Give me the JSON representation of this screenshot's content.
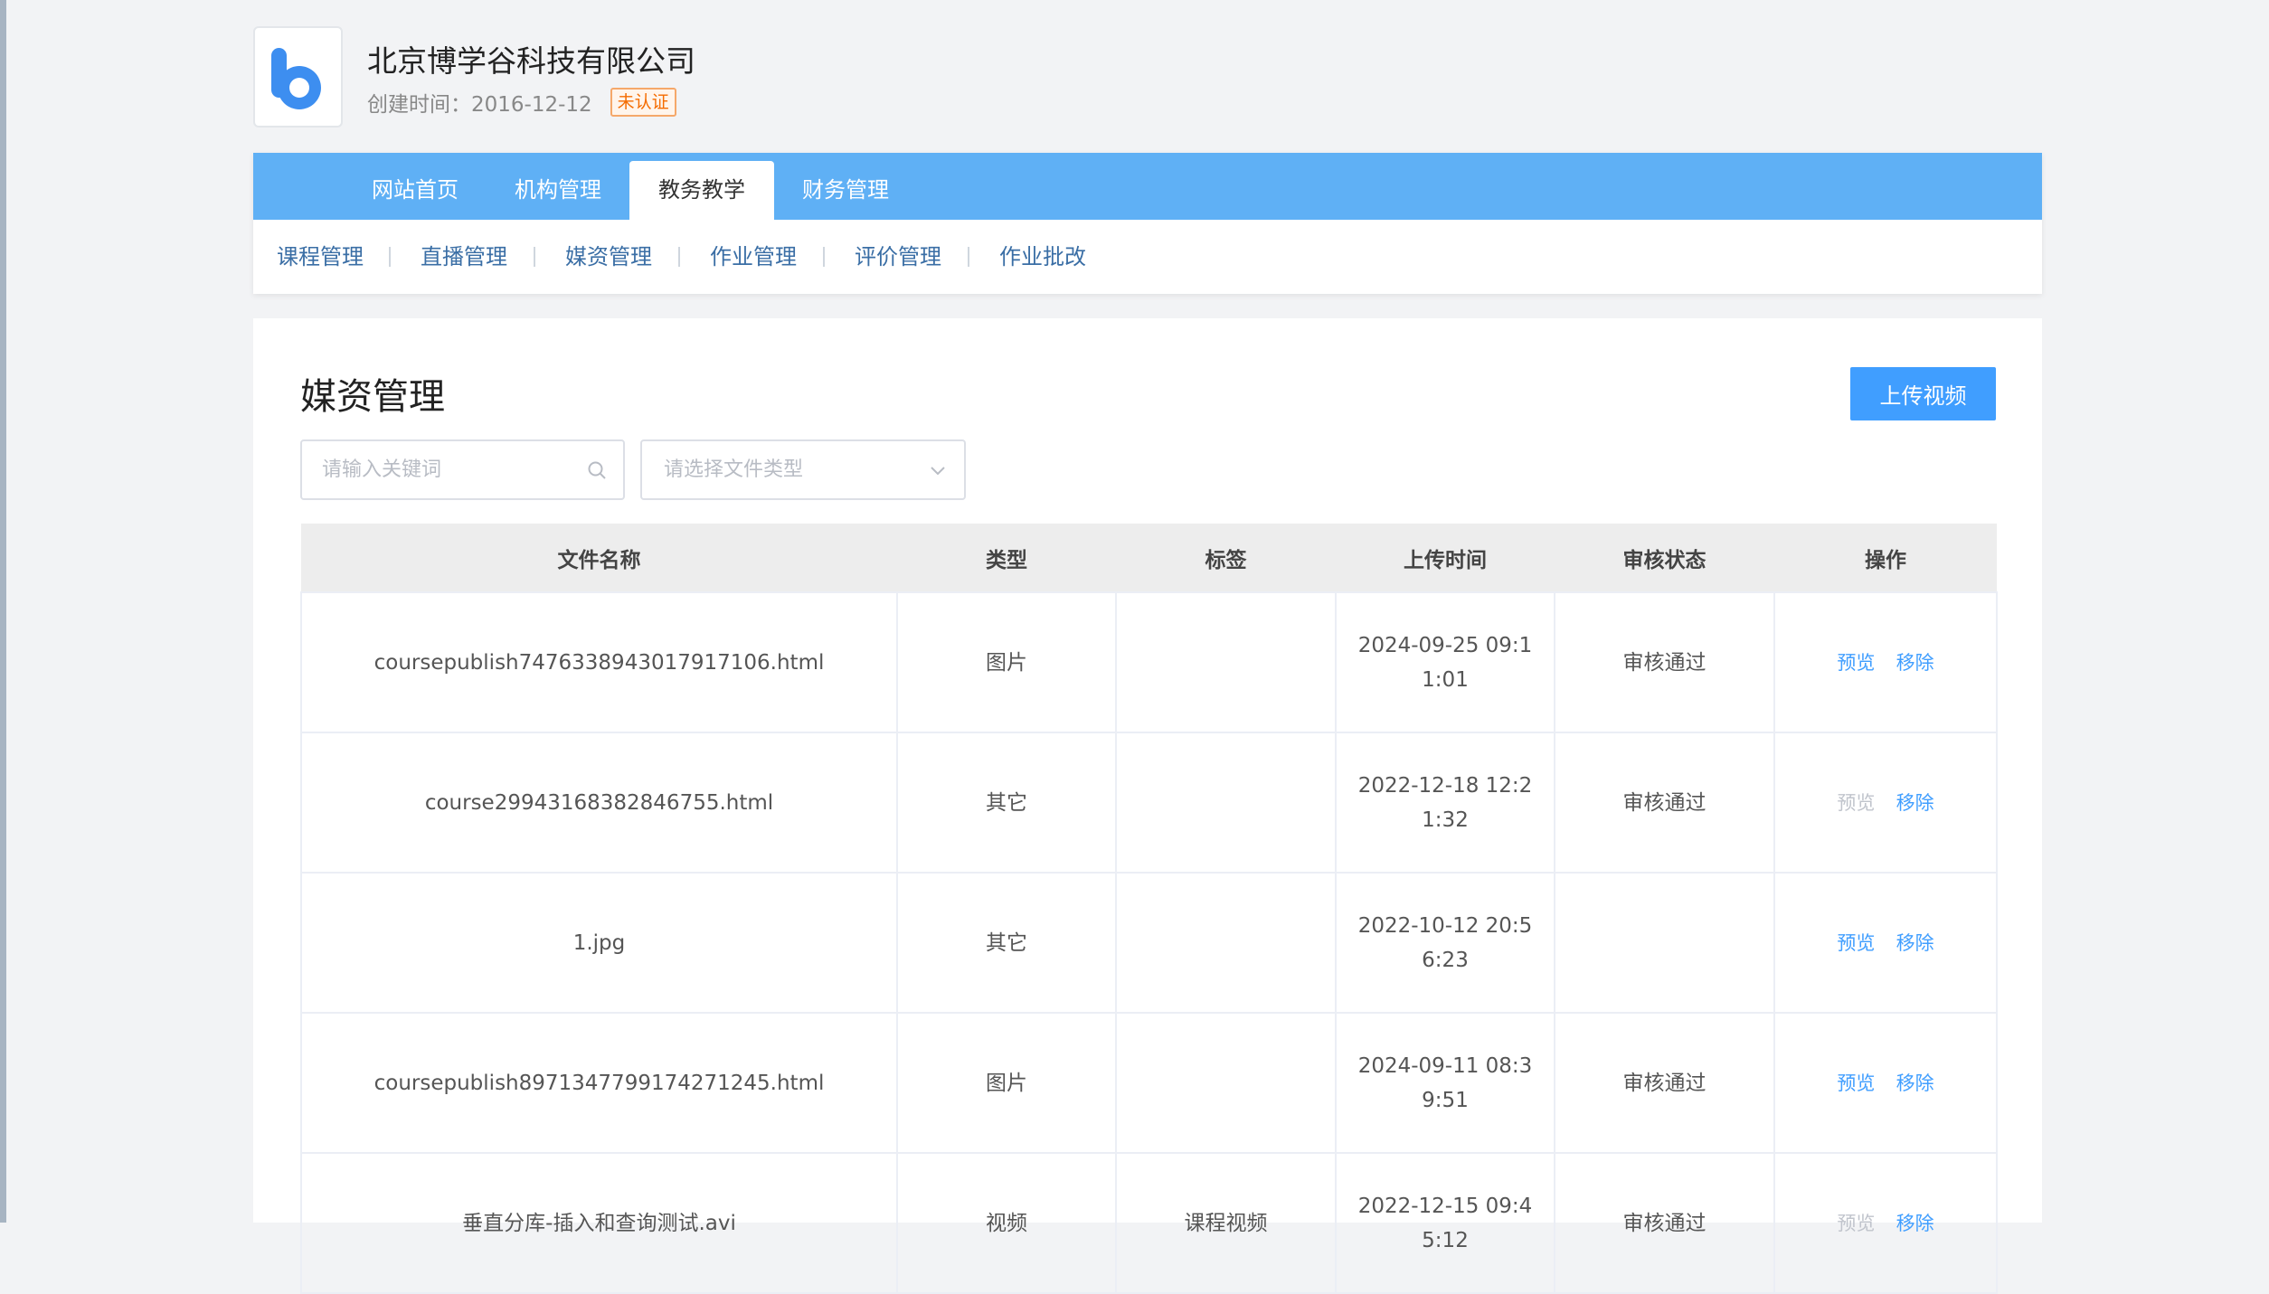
{
  "company": {
    "name": "北京博学谷科技有限公司",
    "created": "创建时间：2016-12-12",
    "badge": "未认证"
  },
  "main_nav": [
    "网站首页",
    "机构管理",
    "教务教学",
    "财务管理"
  ],
  "active_main": "教务教学",
  "sub_nav": [
    "课程管理",
    "直播管理",
    "媒资管理",
    "作业管理",
    "评价管理",
    "作业批改"
  ],
  "page": {
    "title": "媒资管理",
    "upload_label": "上传视频",
    "search_placeholder": "请输入关键词",
    "type_placeholder": "请选择文件类型"
  },
  "table": {
    "headers": [
      "文件名称",
      "类型",
      "标签",
      "上传时间",
      "审核状态",
      "操作"
    ],
    "preview_label": "预览",
    "remove_label": "移除",
    "rows": [
      {
        "name": "coursepublish7476338943017917106.html",
        "type": "图片",
        "tag": "",
        "time": "2024-09-25 09:11:01",
        "status": "审核通过",
        "preview_enabled": true
      },
      {
        "name": "course29943168382846755.html",
        "type": "其它",
        "tag": "",
        "time": "2022-12-18 12:21:32",
        "status": "审核通过",
        "preview_enabled": false
      },
      {
        "name": "1.jpg",
        "type": "其它",
        "tag": "",
        "time": "2022-10-12 20:56:23",
        "status": "",
        "preview_enabled": true
      },
      {
        "name": "coursepublish8971347799174271245.html",
        "type": "图片",
        "tag": "",
        "time": "2024-09-11 08:39:51",
        "status": "审核通过",
        "preview_enabled": true
      },
      {
        "name": "垂直分库-插入和查询测试.avi",
        "type": "视频",
        "tag": "课程视频",
        "time": "2022-12-15 09:45:12",
        "status": "审核通过",
        "preview_enabled": false
      }
    ]
  },
  "colors": {
    "primary": "#409eff",
    "nav_bar": "#5fb0f5",
    "badge": "#f56c00"
  }
}
